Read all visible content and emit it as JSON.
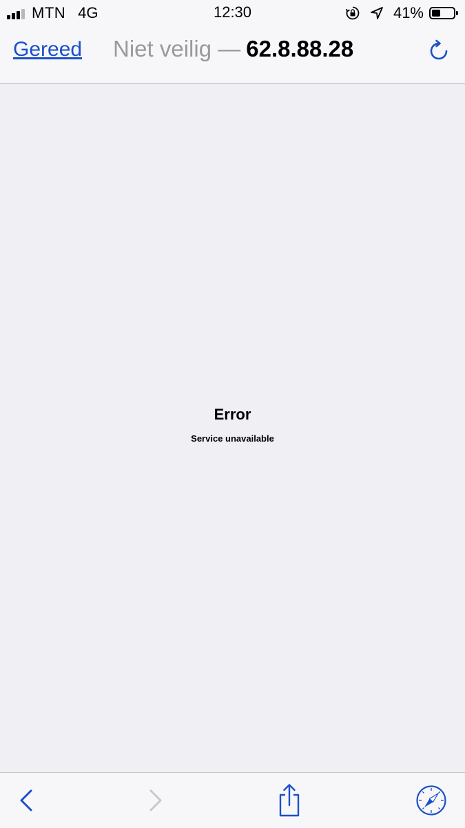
{
  "status_bar": {
    "carrier": "MTN",
    "network": "4G",
    "time": "12:30",
    "battery_percent_label": "41%",
    "battery_level": 0.41,
    "icons": [
      "signal-bars-icon",
      "rotation-lock-icon",
      "location-arrow-icon",
      "battery-icon"
    ]
  },
  "nav": {
    "done_label": "Gereed",
    "security_label": "Niet veilig —",
    "host": "62.8.88.28",
    "reload_icon": "reload-icon"
  },
  "page": {
    "error_title": "Error",
    "error_message": "Service unavailable"
  },
  "toolbar": {
    "icons": [
      "back-chevron-icon",
      "forward-chevron-icon",
      "share-icon",
      "safari-compass-icon"
    ]
  },
  "colors": {
    "link_blue": "#1a4fc9",
    "bar_background": "#f7f7f9",
    "content_background": "#efeff4",
    "disabled_gray": "#c7c7cc",
    "secondary_text": "#9a9a9e"
  }
}
